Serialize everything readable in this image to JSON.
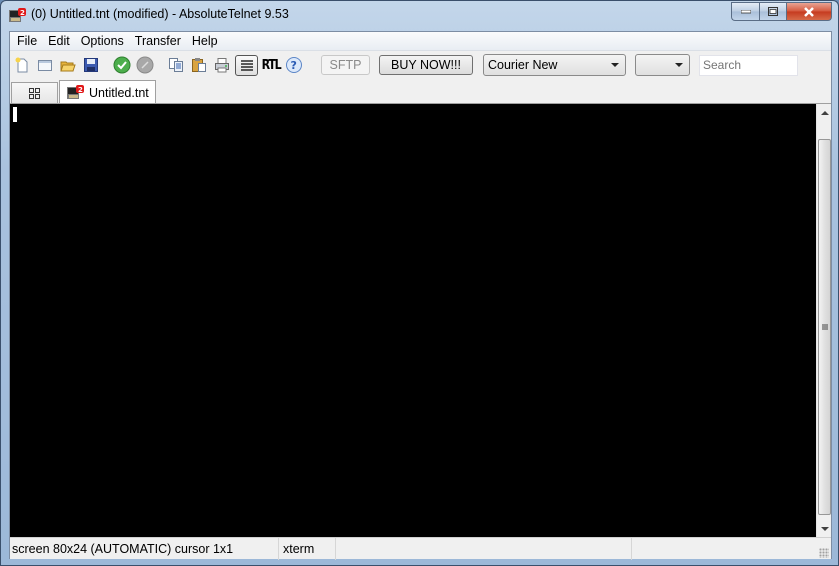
{
  "window": {
    "title": "(0) Untitled.tnt (modified) - AbsoluteTelnet 9.53",
    "controls": [
      "minimize",
      "maximize",
      "close"
    ]
  },
  "menubar": {
    "items": [
      {
        "label": "File"
      },
      {
        "label": "Edit"
      },
      {
        "label": "Options"
      },
      {
        "label": "Transfer"
      },
      {
        "label": "Help"
      }
    ]
  },
  "toolbar": {
    "icons": [
      {
        "name": "new-icon",
        "tooltip": "New"
      },
      {
        "name": "new-window-icon",
        "tooltip": "New Window"
      },
      {
        "name": "open-icon",
        "tooltip": "Open"
      },
      {
        "name": "save-icon",
        "tooltip": "Save"
      },
      {
        "name": "connect-icon",
        "tooltip": "Connect"
      },
      {
        "name": "disconnect-icon",
        "tooltip": "Disconnect"
      },
      {
        "name": "copy-icon",
        "tooltip": "Copy"
      },
      {
        "name": "paste-icon",
        "tooltip": "Paste"
      },
      {
        "name": "print-icon",
        "tooltip": "Print"
      },
      {
        "name": "text-mode-icon",
        "tooltip": "Text"
      },
      {
        "name": "rtl-icon",
        "tooltip": "RTL"
      },
      {
        "name": "help-icon",
        "tooltip": "Help"
      }
    ],
    "rtl_label": "RTL",
    "sftp_label": "SFTP",
    "buy_label": "BUY NOW!!!",
    "font_select": {
      "value": "Courier New"
    },
    "size_select": {
      "value": ""
    },
    "search": {
      "value": "",
      "placeholder": "Search"
    }
  },
  "tabs": {
    "items": [
      {
        "label": "Untitled.tnt",
        "active": true
      }
    ]
  },
  "terminal": {
    "content": ""
  },
  "statusbar": {
    "screen": "screen 80x24 (AUTOMATIC) cursor 1x1",
    "emulation": "xterm",
    "cell3": "",
    "cell4": ""
  }
}
